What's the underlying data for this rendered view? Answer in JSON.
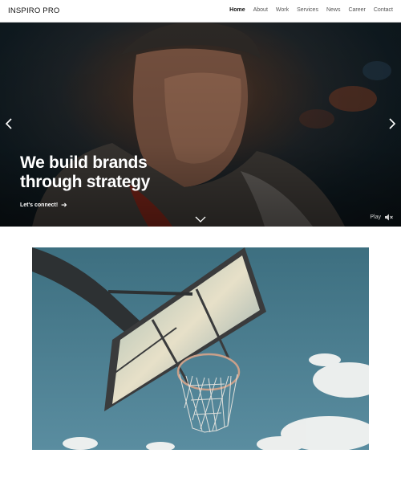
{
  "header": {
    "logo": "INSPIRO PRO",
    "nav": [
      {
        "label": "Home",
        "active": true
      },
      {
        "label": "About"
      },
      {
        "label": "Work"
      },
      {
        "label": "Services"
      },
      {
        "label": "News"
      },
      {
        "label": "Career"
      },
      {
        "label": "Contact"
      }
    ]
  },
  "hero": {
    "title_line1": "We build brands",
    "title_line2": "through strategy",
    "cta_label": "Let's connect!",
    "cta_icon": "arrow-right-icon",
    "prev_icon": "chevron-left-icon",
    "next_icon": "chevron-right-icon",
    "scroll_icon": "chevron-down-icon",
    "play_label": "Play",
    "mute_icon": "speaker-muted-icon"
  },
  "gallery": {
    "image_subject": "basketball-hoop-photo"
  },
  "colors": {
    "text_dark": "#111111",
    "nav_text": "#555555",
    "hero_text": "#ffffff",
    "sky": "#4d7d8f"
  }
}
